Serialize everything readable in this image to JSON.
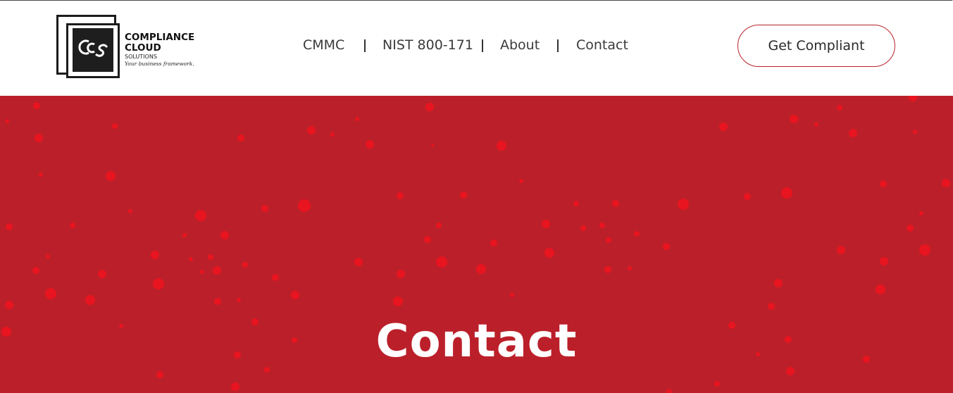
{
  "brand": {
    "name_line1": "COMPLIANCE",
    "name_line2": "CLOUD",
    "name_line3": "SOLUTIONS",
    "tagline": "Your business framework.",
    "monogram": "CCS"
  },
  "nav": {
    "items": [
      {
        "label": "CMMC"
      },
      {
        "label": "NIST 800-171"
      },
      {
        "label": "About"
      },
      {
        "label": "Contact"
      }
    ]
  },
  "header": {
    "cta_label": "Get Compliant"
  },
  "hero": {
    "title": "Contact",
    "background_color": "#bb202a",
    "particle_color": "#e8141f"
  },
  "colors": {
    "accent": "#bb202a",
    "cta_border": "#b8232b",
    "text": "#3a3a3a"
  },
  "icons": {
    "logo": "ccs-logo-icon"
  }
}
